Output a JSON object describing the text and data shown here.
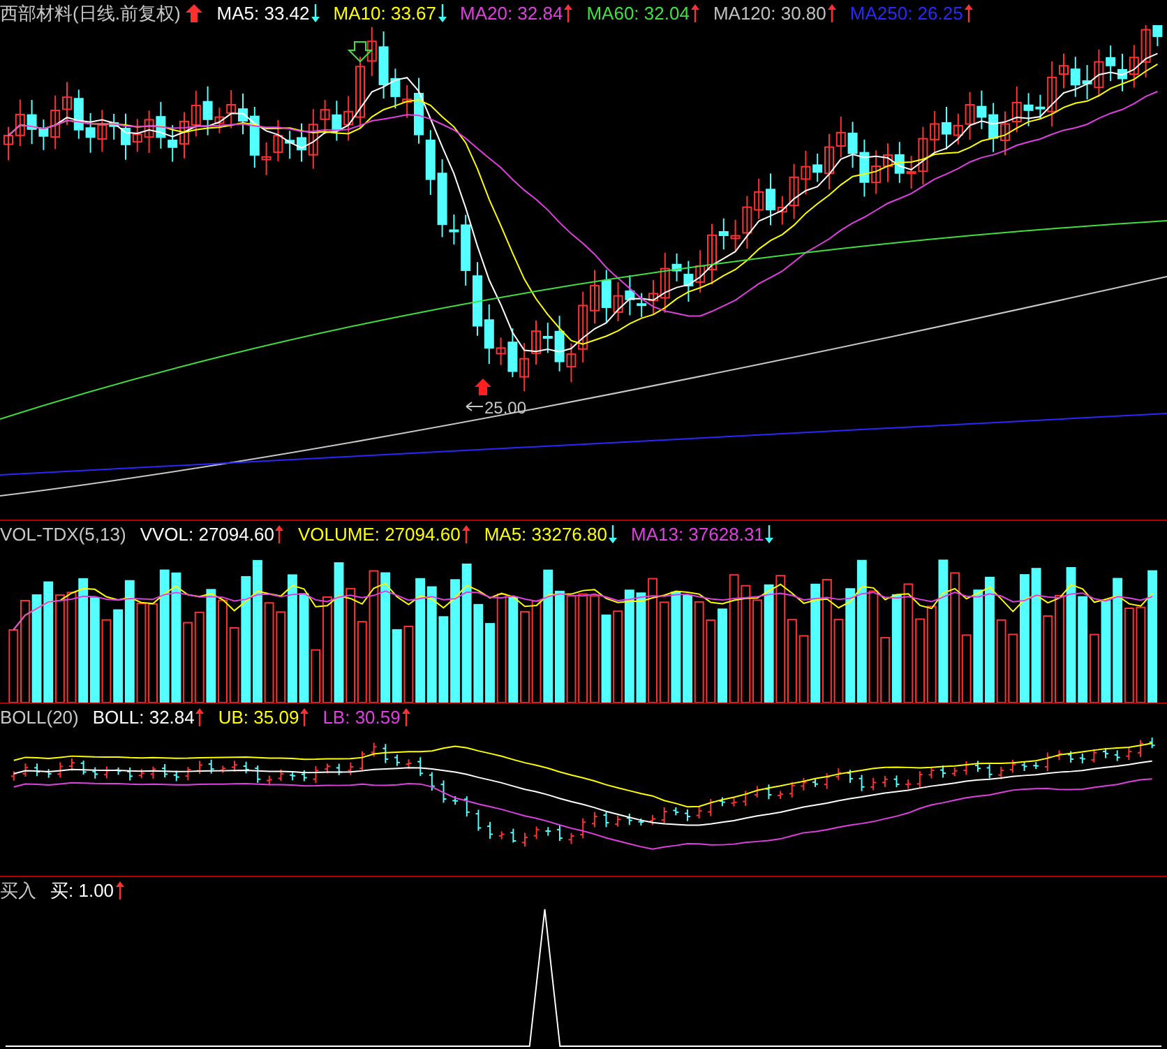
{
  "main": {
    "title": "西部材料(日线.前复权)",
    "rising": true,
    "indicators": [
      {
        "label": "MA5: 33.42",
        "color": "#ffffff",
        "rising": false
      },
      {
        "label": "MA10: 33.67",
        "color": "#ffff00",
        "rising": false
      },
      {
        "label": "MA20: 32.84",
        "color": "#e040e0",
        "rising": true
      },
      {
        "label": "MA60: 32.04",
        "color": "#40e040",
        "rising": true
      },
      {
        "label": "MA120: 30.80",
        "color": "#c0c0c0",
        "rising": true
      },
      {
        "label": "MA250: 26.25",
        "color": "#2828ff",
        "rising": true
      }
    ],
    "low_label": "25.00"
  },
  "volume": {
    "title": "VOL-TDX(5,13)",
    "indicators": [
      {
        "label": "VVOL: 27094.60",
        "color": "#ffffff",
        "rising": true
      },
      {
        "label": "VOLUME: 27094.60",
        "color": "#ffff00",
        "rising": true
      },
      {
        "label": "MA5: 33276.80",
        "color": "#ffff00",
        "rising": false
      },
      {
        "label": "MA13: 37628.31",
        "color": "#e040e0",
        "rising": false
      }
    ]
  },
  "boll": {
    "title": "BOLL(20)",
    "indicators": [
      {
        "label": "BOLL: 32.84",
        "color": "#ffffff",
        "rising": true
      },
      {
        "label": "UB: 35.09",
        "color": "#ffff00",
        "rising": true
      },
      {
        "label": "LB: 30.59",
        "color": "#e040e0",
        "rising": true
      }
    ]
  },
  "signal": {
    "title": "买入",
    "indicators": [
      {
        "label": "买: 1.00",
        "color": "#ffffff",
        "rising": true
      }
    ]
  }
}
